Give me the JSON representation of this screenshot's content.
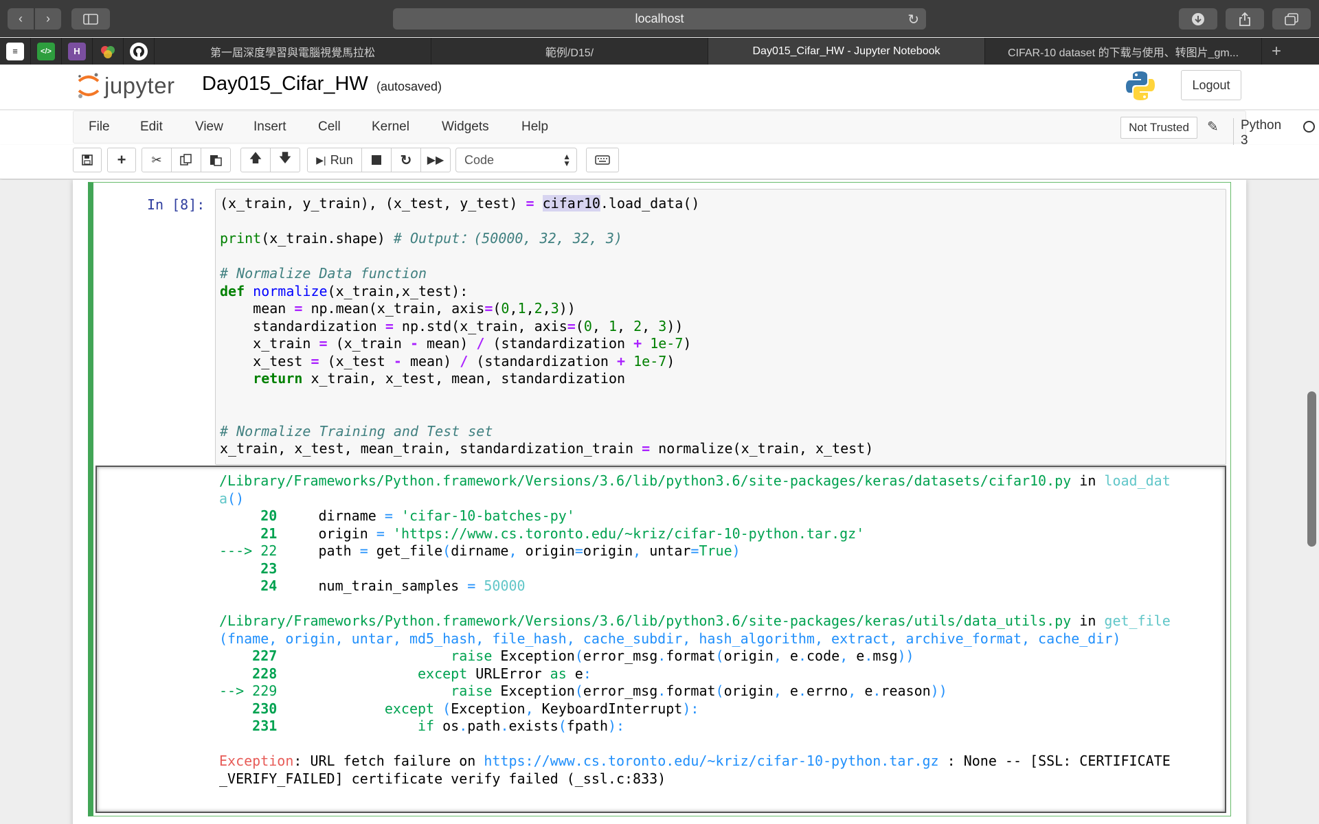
{
  "browser": {
    "address": "localhost",
    "tabs": [
      {
        "title": "第一屆深度學習與電腦視覺馬拉松",
        "active": false
      },
      {
        "title": "範例/D15/",
        "active": false
      },
      {
        "title": "Day015_Cifar_HW - Jupyter Notebook",
        "active": true
      },
      {
        "title": "CIFAR-10 dataset 的下载与使用、转图片_gm...",
        "active": false
      }
    ],
    "pinned": [
      {
        "icon": "notes-icon",
        "glyph": "≡",
        "color": "#ffffff"
      },
      {
        "icon": "code-icon",
        "glyph": "</>",
        "color": "#2e9e3e"
      },
      {
        "icon": "h-icon",
        "glyph": "H",
        "color": "#7b4fa0"
      },
      {
        "icon": "colorful-icon",
        "glyph": "◆",
        "color": "#2f2f2f"
      },
      {
        "icon": "github-icon",
        "glyph": "●",
        "color": "#ffffff"
      }
    ]
  },
  "header": {
    "logo_text": "jupyter",
    "notebook_title": "Day015_Cifar_HW",
    "autosave": "(autosaved)",
    "logout": "Logout"
  },
  "menu": {
    "items": [
      "File",
      "Edit",
      "View",
      "Insert",
      "Cell",
      "Kernel",
      "Widgets",
      "Help"
    ],
    "trust": "Not Trusted",
    "kernel": "Python 3"
  },
  "toolbar": {
    "run_label": "Run",
    "cell_type": "Code"
  },
  "cell": {
    "prompt": "In [8]:",
    "input_lines": [
      "(x_train, y_train), (x_test, y_test) = cifar10.load_data()",
      "",
      "print(x_train.shape) # Output：(50000, 32, 32, 3)",
      "",
      "# Normalize Data function",
      "def normalize(x_train,x_test):",
      "    mean = np.mean(x_train, axis=(0,1,2,3))",
      "    standardization = np.std(x_train, axis=(0, 1, 2, 3))",
      "    x_train = (x_train - mean) / (standardization + 1e-7)",
      "    x_test = (x_test - mean) / (standardization + 1e-7)",
      "    return x_train, x_test, mean, standardization",
      "",
      "",
      "# Normalize Training and Test set",
      "x_train, x_test, mean_train, standardization_train = normalize(x_train, x_test)"
    ],
    "output_lines": [
      "/Library/Frameworks/Python.framework/Versions/3.6/lib/python3.6/site-packages/keras/datasets/cifar10.py in load_dat",
      "a()",
      "     20     dirname = 'cifar-10-batches-py'",
      "     21     origin = 'https://www.cs.toronto.edu/~kriz/cifar-10-python.tar.gz'",
      "---> 22     path = get_file(dirname, origin=origin, untar=True)",
      "     23",
      "     24     num_train_samples = 50000",
      "",
      "/Library/Frameworks/Python.framework/Versions/3.6/lib/python3.6/site-packages/keras/utils/data_utils.py in get_file",
      "(fname, origin, untar, md5_hash, file_hash, cache_subdir, hash_algorithm, extract, archive_format, cache_dir)",
      "    227                     raise Exception(error_msg.format(origin, e.code, e.msg))",
      "    228                 except URLError as e:",
      "--> 229                     raise Exception(error_msg.format(origin, e.errno, e.reason))",
      "    230             except (Exception, KeyboardInterrupt):",
      "    231                 if os.path.exists(fpath):",
      "",
      "Exception: URL fetch failure on https://www.cs.toronto.edu/~kriz/cifar-10-python.tar.gz : None -- [SSL: CERTIFICATE",
      "_VERIFY_FAILED] certificate verify failed (_ssl.c:833)"
    ]
  }
}
